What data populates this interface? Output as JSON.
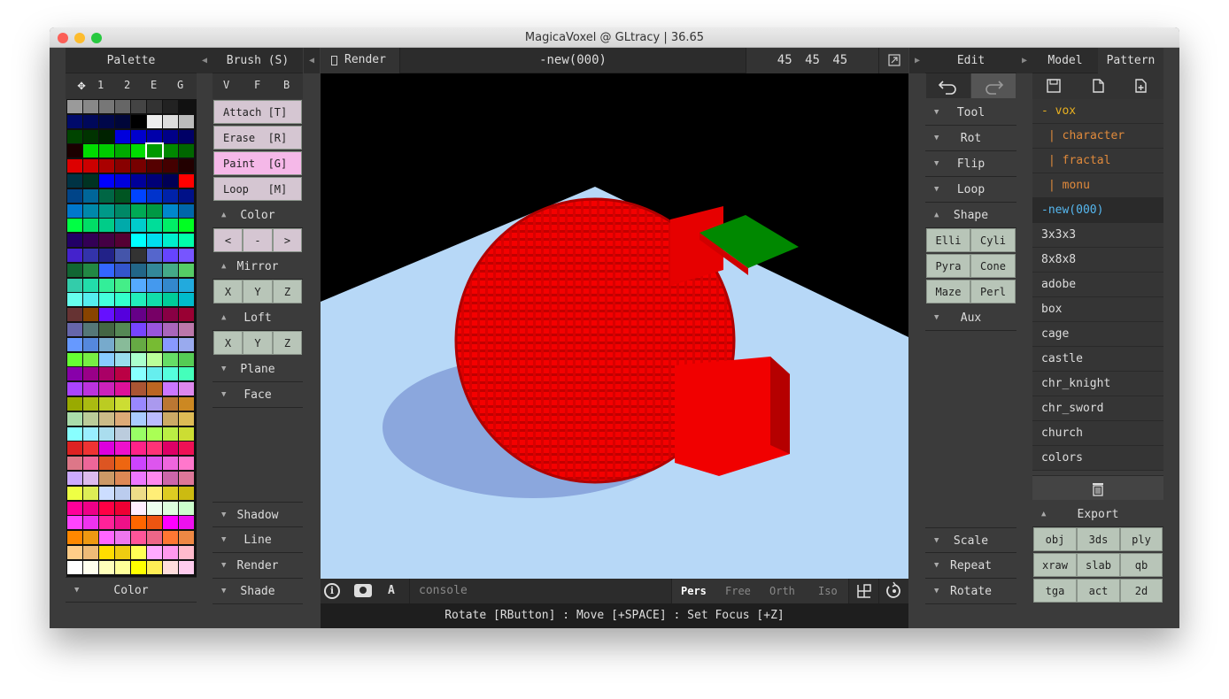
{
  "window": {
    "title": "MagicaVoxel @ GLtracy | 36.65"
  },
  "palette": {
    "header": "Palette",
    "tabs": [
      "1",
      "2",
      "E",
      "G"
    ],
    "footer": "Color"
  },
  "brush": {
    "header": "Brush (S)",
    "modes": [
      "V",
      "F",
      "B"
    ],
    "actions": [
      "Attach [T]",
      "Erase  [R]",
      "Paint  [G]",
      "Loop   [M]"
    ],
    "color_section": "Color",
    "color_nav": [
      "<",
      "-",
      ">"
    ],
    "mirror_section": "Mirror",
    "mirror_axes": [
      "X",
      "Y",
      "Z"
    ],
    "loft_section": "Loft",
    "loft_axes": [
      "X",
      "Y",
      "Z"
    ],
    "plane_section": "Plane",
    "face_section": "Face",
    "lower_sections": [
      "Shadow",
      "Line",
      "Render",
      "Shade"
    ]
  },
  "viewport": {
    "render_label": "Render",
    "title": "-new(000)",
    "dims": "45 45 45",
    "console_placeholder": "console",
    "info_button": "i",
    "a_button": "A",
    "views": [
      "Pers",
      "Free",
      "Orth",
      "Iso"
    ],
    "active_view": "Pers",
    "status": "Rotate [RButton] : Move [+SPACE] : Set Focus [+Z]"
  },
  "edit": {
    "header": "Edit",
    "sections": [
      "Tool",
      "Rot",
      "Flip",
      "Loop"
    ],
    "shape_section": "Shape",
    "shape_buttons": [
      "Elli",
      "Cyli",
      "Pyra",
      "Cone",
      "Maze",
      "Perl"
    ],
    "aux_section": "Aux",
    "lower_sections": [
      "Scale",
      "Repeat",
      "Rotate"
    ]
  },
  "model": {
    "tabs": [
      "Model",
      "Pattern"
    ],
    "tree": [
      {
        "label": "- vox",
        "color": "#e8b020"
      },
      {
        "label": "| character",
        "color": "#e08a3c"
      },
      {
        "label": "| fractal",
        "color": "#e08a3c"
      },
      {
        "label": "| monu",
        "color": "#e08a3c"
      },
      {
        "label": "-new(000)",
        "color": "#56b8f0",
        "selected": true
      }
    ],
    "files": [
      "3x3x3",
      "8x8x8",
      "adobe",
      "box",
      "cage",
      "castle",
      "chr_knight",
      "chr_sword",
      "church",
      "colors"
    ],
    "export_section": "Export",
    "export_buttons": [
      "obj",
      "3ds",
      "ply",
      "xraw",
      "slab",
      "qb",
      "tga",
      "act",
      "2d"
    ]
  },
  "colors": {
    "accent_pink": "#f5b8e8",
    "button_green": "#b7c4b5",
    "brush_button": "#d5c6d2",
    "model_red": "#ff0000",
    "ground": "#b7d8f7"
  }
}
